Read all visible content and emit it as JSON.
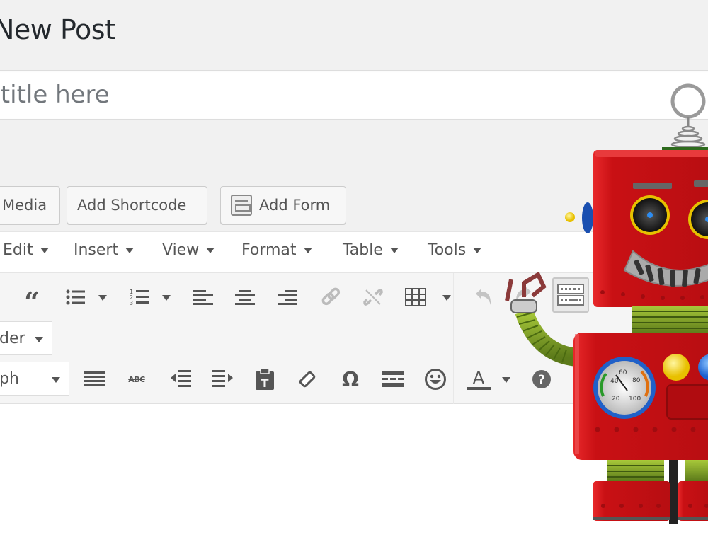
{
  "page": {
    "title": "New Post"
  },
  "title_field": {
    "placeholder": "Enter title here",
    "visible_placeholder": "r title here",
    "value": ""
  },
  "media_buttons": [
    {
      "label": "Add Media",
      "visible_label": "Media",
      "icon": "media-icon"
    },
    {
      "label": "Add Shortcode",
      "visible_label": "Add Shortcode"
    },
    {
      "label": "Add Form",
      "visible_label": "Add Form",
      "icon": "form-icon"
    }
  ],
  "menubar": {
    "items": [
      {
        "label": "Edit"
      },
      {
        "label": "Insert"
      },
      {
        "label": "View"
      },
      {
        "label": "Format"
      },
      {
        "label": "Table"
      },
      {
        "label": "Tools"
      }
    ]
  },
  "toolbar_row1": {
    "buttons": [
      {
        "name": "blockquote",
        "icon": "blockquote-icon"
      },
      {
        "name": "bullet-list",
        "icon": "bullet-list-icon",
        "has_dropdown": true
      },
      {
        "name": "numbered-list",
        "icon": "numbered-list-icon",
        "has_dropdown": true
      },
      {
        "name": "align-left",
        "icon": "align-left-icon"
      },
      {
        "name": "align-center",
        "icon": "align-center-icon"
      },
      {
        "name": "align-right",
        "icon": "align-right-icon"
      },
      {
        "name": "insert-link",
        "icon": "link-icon"
      },
      {
        "name": "remove-link",
        "icon": "unlink-icon"
      },
      {
        "name": "table",
        "icon": "table-icon",
        "has_dropdown": true
      },
      {
        "name": "undo",
        "icon": "undo-icon"
      },
      {
        "name": "redo",
        "icon": "redo-icon"
      },
      {
        "name": "toolbar-toggle",
        "icon": "kitchen-sink-icon"
      }
    ]
  },
  "toolbar_row2": {
    "select_value": "der"
  },
  "toolbar_row3": {
    "format_select_value": "ph",
    "buttons": [
      {
        "name": "justify",
        "icon": "align-justify-icon"
      },
      {
        "name": "strikethrough",
        "icon": "strikethrough-icon",
        "glyph": "ABC"
      },
      {
        "name": "outdent",
        "icon": "outdent-icon"
      },
      {
        "name": "indent",
        "icon": "indent-icon"
      },
      {
        "name": "paste-as-text",
        "icon": "paste-text-icon"
      },
      {
        "name": "clear-formatting",
        "icon": "eraser-icon"
      },
      {
        "name": "special-character",
        "icon": "omega-icon",
        "glyph": "Ω"
      },
      {
        "name": "horizontal-line",
        "icon": "horizontal-line-icon"
      },
      {
        "name": "emoticons",
        "icon": "smiley-icon",
        "glyph": "☺"
      },
      {
        "name": "text-color",
        "icon": "text-color-icon",
        "glyph": "A",
        "has_dropdown": true
      },
      {
        "name": "help",
        "icon": "help-icon",
        "glyph": "?"
      }
    ]
  },
  "robot": {
    "gauge_labels": [
      "20",
      "40",
      "60",
      "80",
      "100"
    ]
  },
  "colors": {
    "background": "#f1f1f1",
    "robot_red": "#d8181c",
    "robot_green": "#6b8e23",
    "icon_gray": "#555555"
  }
}
